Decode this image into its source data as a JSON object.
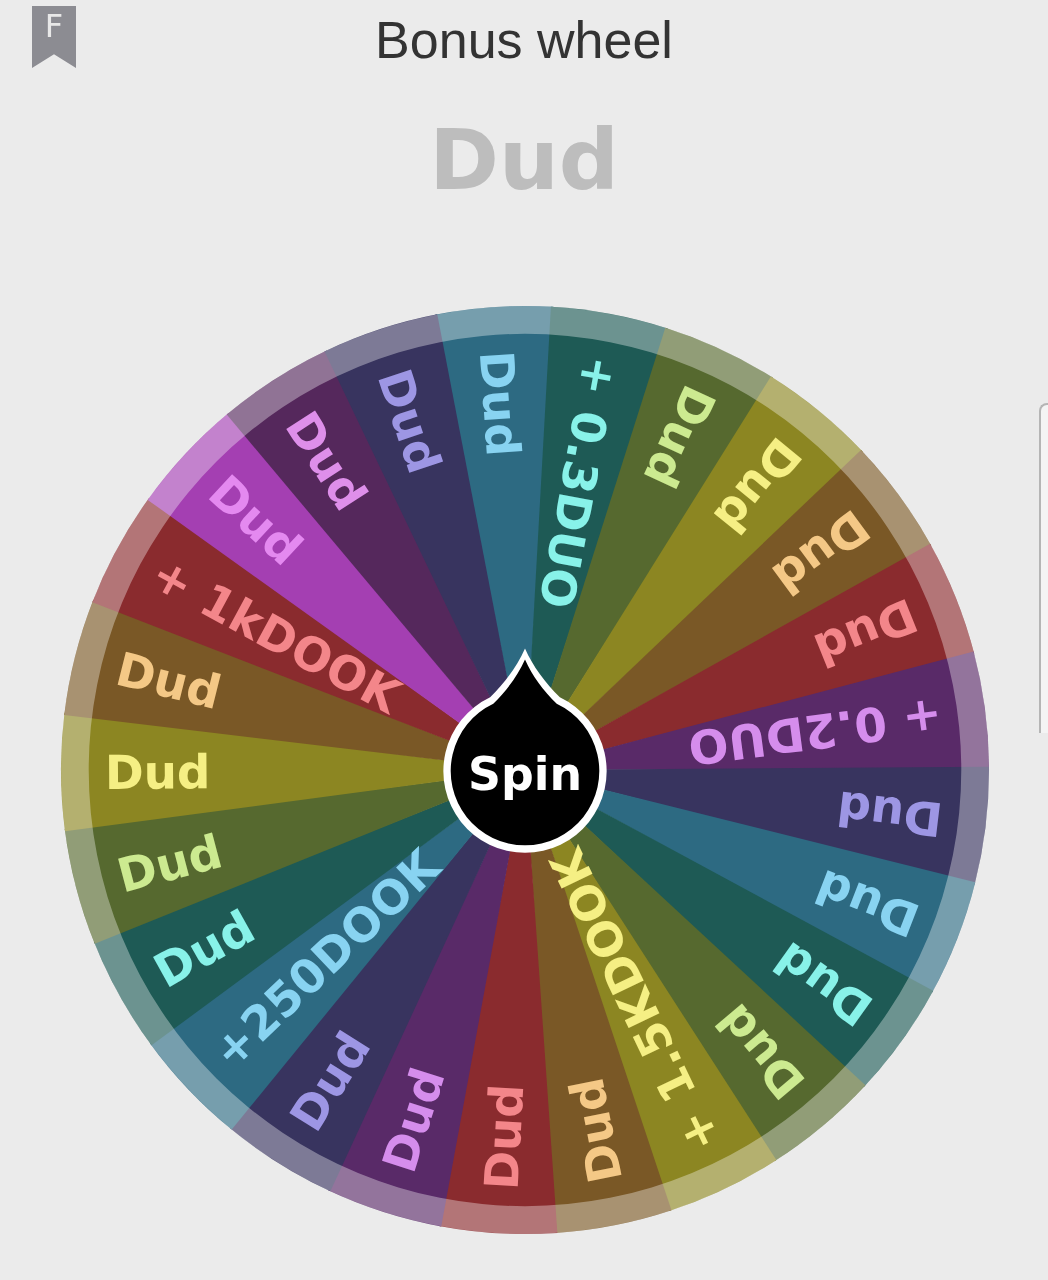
{
  "header": {
    "badge": "F",
    "title": "Bonus wheel"
  },
  "result": "Dud",
  "wheel": {
    "spin_label": "Spin",
    "segments": [
      {
        "label": "Dud",
        "color": "#2d6a82"
      },
      {
        "label": "+ 0.3DUO",
        "color": "#1e5a55"
      },
      {
        "label": "Dud",
        "color": "#56692f"
      },
      {
        "label": "Dud",
        "color": "#8c8622"
      },
      {
        "label": "Dud",
        "color": "#7a5826"
      },
      {
        "label": "Dud",
        "color": "#8a2b2e"
      },
      {
        "label": "+ 0.2DUO",
        "color": "#592a68"
      },
      {
        "label": "Dud",
        "color": "#38345f"
      },
      {
        "label": "Dud",
        "color": "#2d6a82"
      },
      {
        "label": "Dud",
        "color": "#1e5a55"
      },
      {
        "label": "Dud",
        "color": "#56692f"
      },
      {
        "label": "+ 1.5KDOOK",
        "color": "#8c8622"
      },
      {
        "label": "Dud",
        "color": "#7a5826"
      },
      {
        "label": "Dud",
        "color": "#8a2b2e"
      },
      {
        "label": "Dud",
        "color": "#592a68"
      },
      {
        "label": "Dud",
        "color": "#38345f"
      },
      {
        "label": "+250DOOK",
        "color": "#2d6a82"
      },
      {
        "label": "Dud",
        "color": "#1e5a55"
      },
      {
        "label": "Dud",
        "color": "#56692f"
      },
      {
        "label": "Dud",
        "color": "#8c8622"
      },
      {
        "label": "Dud",
        "color": "#7a5826"
      },
      {
        "label": "+ 1kDOOK",
        "color": "#8a2b2e"
      },
      {
        "label": "Dud",
        "color": "#a43fb2"
      },
      {
        "label": "Dud",
        "color": "#55285c"
      },
      {
        "label": "Dud",
        "color": "#38345f"
      }
    ]
  }
}
